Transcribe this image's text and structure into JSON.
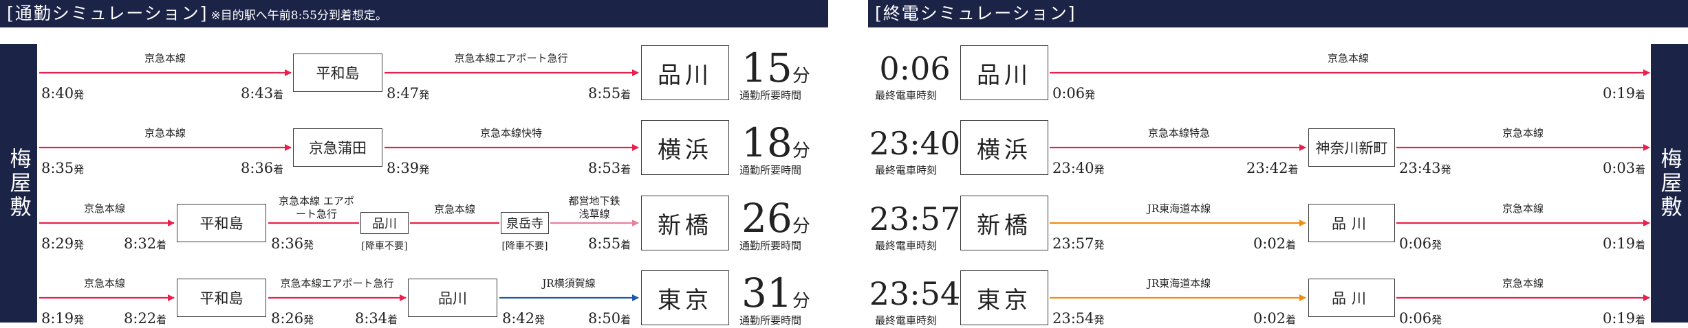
{
  "colors": {
    "navy": "#1b2447",
    "red": "#e8204d",
    "pink": "#ea7e9d",
    "orange": "#ef8d10",
    "blue": "#1f59a8"
  },
  "left_header": {
    "title": "[通勤シミュレーション]",
    "note": "※目的駅へ午前8:55分到着想定。"
  },
  "right_header": {
    "title": "[終電シミュレーション]"
  },
  "origin_station": "梅屋敷",
  "commute": [
    {
      "departure": "8:40",
      "station1": "平和島",
      "line1": "京急本線",
      "arr1": "8:43",
      "dep2": "8:47",
      "line2": "京急本線エアポート急行",
      "arr_final": "8:55",
      "dest": "品川",
      "minutes": "15",
      "caption": "通勤所要時間"
    },
    {
      "departure": "8:35",
      "station1": "京急蒲田",
      "line1": "京急本線",
      "arr1": "8:36",
      "dep2": "8:39",
      "line2": "京急本線快特",
      "arr_final": "8:53",
      "dest": "横浜",
      "minutes": "18",
      "caption": "通勤所要時間"
    },
    {
      "departure": "8:29",
      "station1": "平和島",
      "line1": "京急本線",
      "arr1": "8:32",
      "dep2": "8:36",
      "line2": "京急本線 エアポート急行",
      "station2": "品川",
      "no_exit2": "[降車不要]",
      "line3": "京急本線",
      "station3": "泉岳寺",
      "no_exit3": "[降車不要]",
      "line4": "都営地下鉄 浅草線",
      "arr_final": "8:55",
      "dest": "新橋",
      "minutes": "26",
      "caption": "通勤所要時間"
    },
    {
      "departure": "8:19",
      "station1": "平和島",
      "line1": "京急本線",
      "arr1": "8:22",
      "dep2": "8:26",
      "line2": "京急本線エアポート急行",
      "arr2": "8:34",
      "station2": "品川",
      "dep3": "8:42",
      "line3": "JR横須賀線",
      "arr_final": "8:50",
      "dest": "東京",
      "minutes": "31",
      "caption": "通勤所要時間"
    }
  ],
  "last_train": [
    {
      "time": "0:06",
      "caption": "最終電車時刻",
      "station": "品川",
      "dep": "0:06",
      "line1": "京急本線",
      "arr": "0:19"
    },
    {
      "time": "23:40",
      "caption": "最終電車時刻",
      "station": "横浜",
      "dep": "23:40",
      "line1": "京急本線特急",
      "arr1": "23:42",
      "transfer": "神奈川新町",
      "dep2": "23:43",
      "line2": "京急本線",
      "arr": "0:03"
    },
    {
      "time": "23:57",
      "caption": "最終電車時刻",
      "station": "新橋",
      "dep": "23:57",
      "line1": "JR東海道本線",
      "arr1": "0:02",
      "transfer": "品川",
      "dep2": "0:06",
      "line2": "京急本線",
      "arr": "0:19"
    },
    {
      "time": "23:54",
      "caption": "最終電車時刻",
      "station": "東京",
      "dep": "23:54",
      "line1": "JR東海道本線",
      "arr1": "0:02",
      "transfer": "品川",
      "dep2": "0:06",
      "line2": "京急本線",
      "arr": "0:19"
    }
  ],
  "units": {
    "dep": "発",
    "arr": "着",
    "min": "分"
  }
}
